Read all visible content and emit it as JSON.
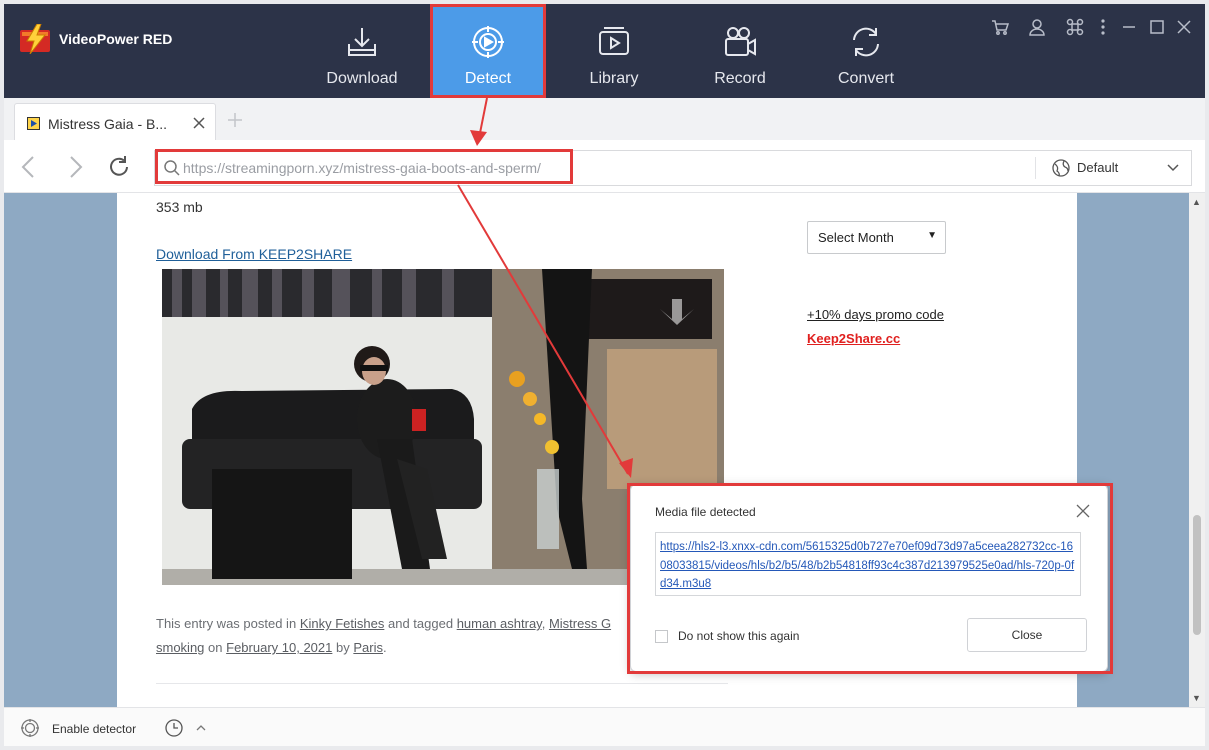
{
  "app": {
    "name": "VideoPower RED",
    "accent_color": "#4c9be8",
    "titlebar_color": "#2c3348"
  },
  "nav": {
    "tabs": [
      {
        "label": "Download",
        "icon": "download-icon"
      },
      {
        "label": "Detect",
        "icon": "detect-icon",
        "active": true
      },
      {
        "label": "Library",
        "icon": "library-icon"
      },
      {
        "label": "Record",
        "icon": "record-icon"
      },
      {
        "label": "Convert",
        "icon": "convert-icon"
      }
    ]
  },
  "window_controls": [
    "cart-icon",
    "user-icon",
    "command-icon",
    "more-icon",
    "minimize-icon",
    "maximize-icon",
    "close-icon"
  ],
  "browser": {
    "tab_title": "Mistress Gaia - B...",
    "url": "https://streamingporn.xyz/mistress-gaia-boots-and-sperm/",
    "resolution": "Default"
  },
  "page": {
    "file_size": "353 mb",
    "download_link": "Download From KEEP2SHARE",
    "entry_prefix": "This entry was posted in",
    "category": "Kinky Fetishes",
    "tagged_text": "and tagged",
    "tag1": "human ashtray",
    "tag2": "Mistress G",
    "tag3": "smoking",
    "on_text": "on",
    "date": "February 10, 2021",
    "by_text": "by",
    "author": "Paris",
    "month_select": "Select Month",
    "promo": "+10% days promo code",
    "promo_site": "Keep2Share.cc"
  },
  "popup": {
    "title": "Media file detected",
    "link": "https://hls2-l3.xnxx-cdn.com/5615325d0b727e70ef09d73d97a5ceea282732cc-1608033815/videos/hls/b2/b5/48/b2b54818ff93c4c387d213979525e0ad/hls-720p-0fd34.m3u8",
    "checkbox_label": "Do not show this again",
    "close_label": "Close"
  },
  "bottom": {
    "detector_label": "Enable detector"
  }
}
